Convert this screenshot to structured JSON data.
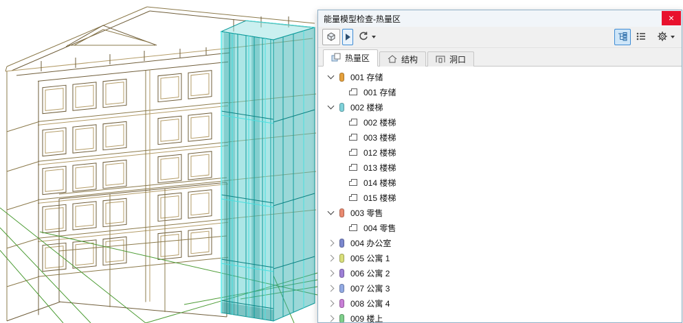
{
  "window": {
    "title": "能量模型检查-热量区",
    "close_glyph": "×"
  },
  "toolbar": {
    "left_buttons": [
      {
        "name": "model-update",
        "icon": "cube-icon"
      },
      {
        "name": "expand-run",
        "icon": "play-icon"
      },
      {
        "name": "refresh",
        "icon": "refresh-icon",
        "dropdown": true
      }
    ],
    "right_buttons": [
      {
        "name": "tree-view",
        "icon": "tree-view-icon",
        "active": true
      },
      {
        "name": "list-view",
        "icon": "list-view-icon",
        "active": false
      },
      {
        "name": "settings",
        "icon": "gear-icon",
        "dropdown": true
      }
    ]
  },
  "tabs": [
    {
      "label": "热量区",
      "active": true
    },
    {
      "label": "结构",
      "active": false
    },
    {
      "label": "洞口",
      "active": false
    }
  ],
  "tree": {
    "groups": [
      {
        "label": "001 存储",
        "color": "#E5A13D",
        "expanded": true,
        "children": [
          "001 存储"
        ]
      },
      {
        "label": "002 楼梯",
        "color": "#7FD2DA",
        "expanded": true,
        "children": [
          "002 楼梯",
          "003 楼梯",
          "012 楼梯",
          "013 楼梯",
          "014 楼梯",
          "015 楼梯"
        ]
      },
      {
        "label": "003 零售",
        "color": "#E98A70",
        "expanded": true,
        "children": [
          "004 零售"
        ]
      },
      {
        "label": "004 办公室",
        "color": "#7B87CE",
        "expanded": false,
        "children": []
      },
      {
        "label": "005 公寓 1",
        "color": "#D9DF7B",
        "expanded": false,
        "children": []
      },
      {
        "label": "006 公寓 2",
        "color": "#9D7FD6",
        "expanded": false,
        "children": []
      },
      {
        "label": "007 公寓 3",
        "color": "#92AAE3",
        "expanded": false,
        "children": []
      },
      {
        "label": "008 公寓 4",
        "color": "#C87FD6",
        "expanded": false,
        "children": []
      },
      {
        "label": "009 楼上",
        "color": "#7FCF8B",
        "expanded": false,
        "children": []
      }
    ]
  },
  "viewport": {
    "selection_color": "#3FC6C6",
    "wireframe_color": "#8A7848",
    "site_color": "#4B9B33"
  }
}
